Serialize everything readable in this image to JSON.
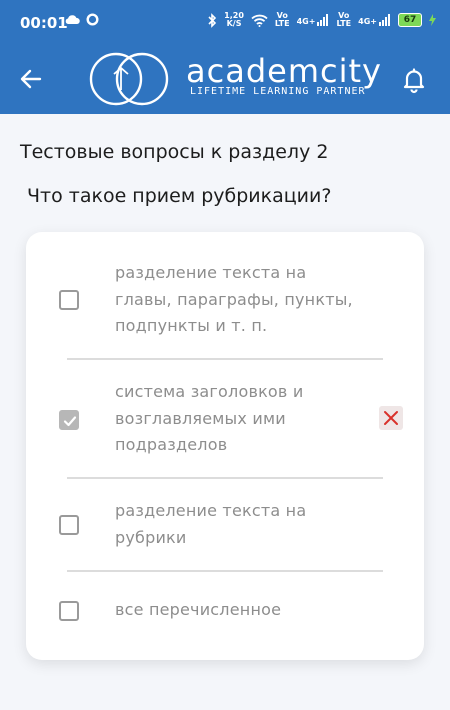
{
  "status_bar": {
    "time": "00:01",
    "speed_value": "1,20",
    "speed_unit": "K/S",
    "sim1_top": "Vo",
    "sim1_bottom": "LTE",
    "sim1_gen": "4G+",
    "sim2_top": "Vo",
    "sim2_bottom": "LTE",
    "sim2_gen": "4G+",
    "battery": "67",
    "accent_color": "#2f74c0"
  },
  "app_bar": {
    "logo_word": "academcity",
    "logo_tagline": "LIFETIME LEARNING PARTNER",
    "back_icon": "arrow-left-icon",
    "bell_icon": "bell-icon"
  },
  "section_title": "Тестовые вопросы к разделу 2",
  "question": "Что такое прием рубрикации?",
  "options": [
    {
      "lines": [
        "разделение текста на",
        "главы, параграфы, пункты,",
        "подпункты и т. п."
      ],
      "checked": false
    },
    {
      "lines": [
        "система заголовков и",
        "возглавляемых ими",
        "подразделов"
      ],
      "checked": true,
      "result_icon": "close-icon",
      "result_color": "#d9312b"
    },
    {
      "lines": [
        "разделение текста на",
        "рубрики"
      ],
      "checked": false
    },
    {
      "lines": [
        "все перечисленное"
      ],
      "checked": false
    }
  ]
}
